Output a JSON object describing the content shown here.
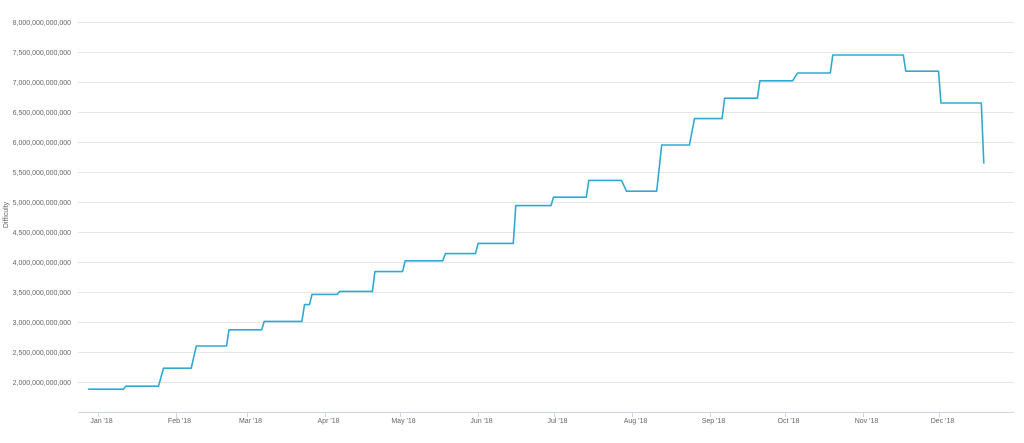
{
  "chart_data": {
    "type": "line",
    "title": "",
    "xlabel": "",
    "ylabel": "Difficulty",
    "ylim": [
      1500000000000,
      8000000000000
    ],
    "xlim": [
      "2017-12-24",
      "2018-12-31"
    ],
    "y_ticks": [
      {
        "value": 2000000000000,
        "label": "2,000,000,000,000"
      },
      {
        "value": 2500000000000,
        "label": "2,500,000,000,000"
      },
      {
        "value": 3000000000000,
        "label": "3,000,000,000,000"
      },
      {
        "value": 3500000000000,
        "label": "3,500,000,000,000"
      },
      {
        "value": 4000000000000,
        "label": "4,000,000,000,000"
      },
      {
        "value": 4500000000000,
        "label": "4,500,000,000,000"
      },
      {
        "value": 5000000000000,
        "label": "5,000,000,000,000"
      },
      {
        "value": 5500000000000,
        "label": "5,500,000,000,000"
      },
      {
        "value": 6000000000000,
        "label": "6,000,000,000,000"
      },
      {
        "value": 6500000000000,
        "label": "6,500,000,000,000"
      },
      {
        "value": 7000000000000,
        "label": "7,000,000,000,000"
      },
      {
        "value": 7500000000000,
        "label": "7,500,000,000,000"
      },
      {
        "value": 8000000000000,
        "label": "8,000,000,000,000"
      }
    ],
    "x_ticks": [
      {
        "date": "2018-01-01",
        "label": "Jan '18"
      },
      {
        "date": "2018-02-01",
        "label": "Feb '18"
      },
      {
        "date": "2018-03-01",
        "label": "Mar '18"
      },
      {
        "date": "2018-04-01",
        "label": "Apr '18"
      },
      {
        "date": "2018-05-01",
        "label": "May '18"
      },
      {
        "date": "2018-06-01",
        "label": "Jun '18"
      },
      {
        "date": "2018-07-01",
        "label": "Jul '18"
      },
      {
        "date": "2018-08-01",
        "label": "Aug '18"
      },
      {
        "date": "2018-09-01",
        "label": "Sep '18"
      },
      {
        "date": "2018-10-01",
        "label": "Oct '18"
      },
      {
        "date": "2018-11-01",
        "label": "Nov '18"
      },
      {
        "date": "2018-12-01",
        "label": "Dec '18"
      }
    ],
    "grid": true,
    "series": [
      {
        "color": "#2fa9d4",
        "x": [
          "2017-12-28",
          "2018-01-11",
          "2018-01-12",
          "2018-01-25",
          "2018-01-27",
          "2018-02-07",
          "2018-02-09",
          "2018-02-21",
          "2018-02-22",
          "2018-03-07",
          "2018-03-08",
          "2018-03-23",
          "2018-03-24",
          "2018-03-26",
          "2018-03-27",
          "2018-04-06",
          "2018-04-07",
          "2018-04-20",
          "2018-04-21",
          "2018-05-02",
          "2018-05-03",
          "2018-05-18",
          "2018-05-19",
          "2018-05-31",
          "2018-06-01",
          "2018-06-15",
          "2018-06-16",
          "2018-06-30",
          "2018-07-01",
          "2018-07-14",
          "2018-07-15",
          "2018-07-28",
          "2018-07-30",
          "2018-08-11",
          "2018-08-13",
          "2018-08-24",
          "2018-08-26",
          "2018-09-06",
          "2018-09-07",
          "2018-09-20",
          "2018-09-21",
          "2018-10-04",
          "2018-10-06",
          "2018-10-19",
          "2018-10-20",
          "2018-11-17",
          "2018-11-18",
          "2018-12-01",
          "2018-12-02",
          "2018-12-18",
          "2018-12-19"
        ],
        "values": [
          1880000000000,
          1880000000000,
          1930000000000,
          1930000000000,
          2230000000000,
          2230000000000,
          2600000000000,
          2600000000000,
          2870000000000,
          2870000000000,
          3010000000000,
          3010000000000,
          3290000000000,
          3290000000000,
          3460000000000,
          3460000000000,
          3510000000000,
          3510000000000,
          3840000000000,
          3840000000000,
          4020000000000,
          4020000000000,
          4140000000000,
          4140000000000,
          4310000000000,
          4310000000000,
          4940000000000,
          4940000000000,
          5080000000000,
          5080000000000,
          5360000000000,
          5360000000000,
          5180000000000,
          5180000000000,
          5950000000000,
          5950000000000,
          6390000000000,
          6390000000000,
          6730000000000,
          6730000000000,
          7020000000000,
          7020000000000,
          7150000000000,
          7150000000000,
          7450000000000,
          7450000000000,
          7180000000000,
          7180000000000,
          6650000000000,
          6650000000000,
          5640000000000
        ]
      }
    ]
  }
}
